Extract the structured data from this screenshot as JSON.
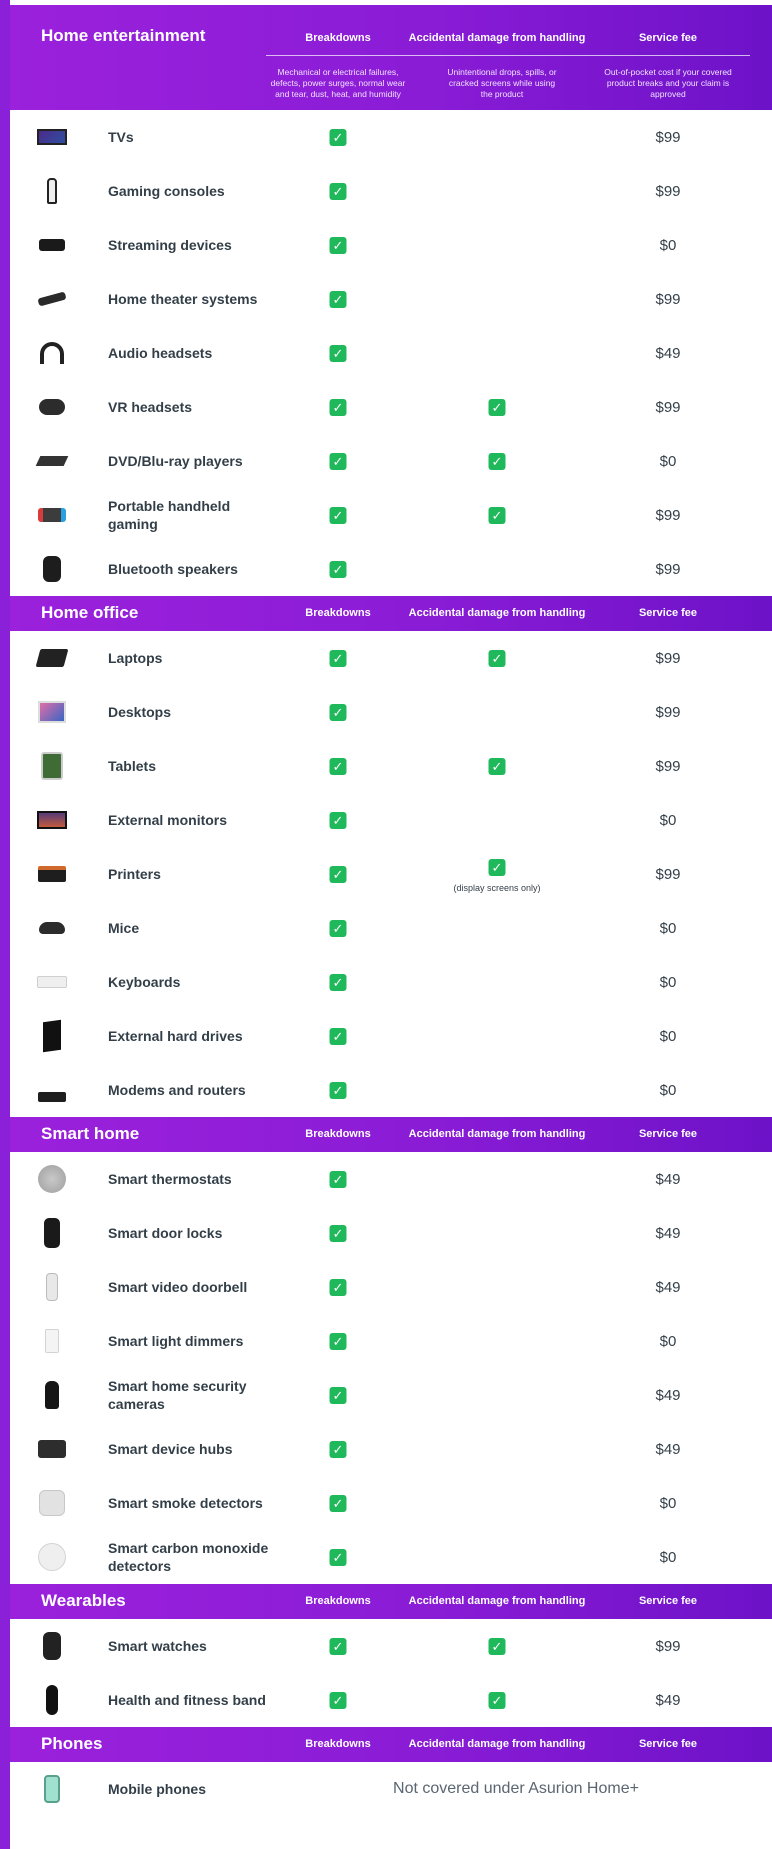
{
  "columns": {
    "breakdowns": "Breakdowns",
    "accidental": "Accidental damage from handling",
    "fee": "Service fee"
  },
  "descriptions": {
    "breakdowns": "Mechanical or electrical failures, defects, power surges, normal wear and tear, dust, heat, and humidity",
    "accidental": "Unintentional drops, spills, or cracked screens while using the product",
    "fee": "Out-of-pocket cost if your covered product breaks and your claim is approved"
  },
  "check_glyph": "✓",
  "sections": [
    {
      "title": "Home entertainment",
      "rows": [
        {
          "name": "TVs",
          "icon": "tv-icon",
          "breakdowns": true,
          "accidental": false,
          "fee": "$99"
        },
        {
          "name": "Gaming consoles",
          "icon": "gaming-console-icon",
          "breakdowns": true,
          "accidental": false,
          "fee": "$99"
        },
        {
          "name": "Streaming devices",
          "icon": "streaming-device-icon",
          "breakdowns": true,
          "accidental": false,
          "fee": "$0"
        },
        {
          "name": "Home theater systems",
          "icon": "soundbar-icon",
          "breakdowns": true,
          "accidental": false,
          "fee": "$99"
        },
        {
          "name": "Audio headsets",
          "icon": "headphones-icon",
          "breakdowns": true,
          "accidental": false,
          "fee": "$49"
        },
        {
          "name": "VR headsets",
          "icon": "vr-headset-icon",
          "breakdowns": true,
          "accidental": true,
          "fee": "$99"
        },
        {
          "name": "DVD/Blu-ray players",
          "icon": "disc-player-icon",
          "breakdowns": true,
          "accidental": true,
          "fee": "$0"
        },
        {
          "name": "Portable handheld gaming",
          "icon": "handheld-console-icon",
          "breakdowns": true,
          "accidental": true,
          "fee": "$99"
        },
        {
          "name": "Bluetooth speakers",
          "icon": "speaker-icon",
          "breakdowns": true,
          "accidental": false,
          "fee": "$99"
        }
      ]
    },
    {
      "title": "Home office",
      "rows": [
        {
          "name": "Laptops",
          "icon": "laptop-icon",
          "breakdowns": true,
          "accidental": true,
          "fee": "$99"
        },
        {
          "name": "Desktops",
          "icon": "desktop-icon",
          "breakdowns": true,
          "accidental": false,
          "fee": "$99"
        },
        {
          "name": "Tablets",
          "icon": "tablet-icon",
          "breakdowns": true,
          "accidental": true,
          "fee": "$99"
        },
        {
          "name": "External monitors",
          "icon": "monitor-icon",
          "breakdowns": true,
          "accidental": false,
          "fee": "$0"
        },
        {
          "name": "Printers",
          "icon": "printer-icon",
          "breakdowns": true,
          "accidental": true,
          "accidental_note": "(display screens only)",
          "fee": "$99"
        },
        {
          "name": "Mice",
          "icon": "mouse-icon",
          "breakdowns": true,
          "accidental": false,
          "fee": "$0"
        },
        {
          "name": "Keyboards",
          "icon": "keyboard-icon",
          "breakdowns": true,
          "accidental": false,
          "fee": "$0"
        },
        {
          "name": "External hard drives",
          "icon": "hard-drive-icon",
          "breakdowns": true,
          "accidental": false,
          "fee": "$0"
        },
        {
          "name": "Modems and routers",
          "icon": "router-icon",
          "breakdowns": true,
          "accidental": false,
          "fee": "$0"
        }
      ]
    },
    {
      "title": "Smart home",
      "rows": [
        {
          "name": "Smart thermostats",
          "icon": "thermostat-icon",
          "breakdowns": true,
          "accidental": false,
          "fee": "$49"
        },
        {
          "name": "Smart door locks",
          "icon": "door-lock-icon",
          "breakdowns": true,
          "accidental": false,
          "fee": "$49"
        },
        {
          "name": "Smart video doorbell",
          "icon": "doorbell-icon",
          "breakdowns": true,
          "accidental": false,
          "fee": "$49"
        },
        {
          "name": "Smart light dimmers",
          "icon": "dimmer-icon",
          "breakdowns": true,
          "accidental": false,
          "fee": "$0"
        },
        {
          "name": "Smart home security cameras",
          "icon": "security-camera-icon",
          "breakdowns": true,
          "accidental": false,
          "fee": "$49"
        },
        {
          "name": "Smart device hubs",
          "icon": "smart-hub-icon",
          "breakdowns": true,
          "accidental": false,
          "fee": "$49"
        },
        {
          "name": "Smart smoke detectors",
          "icon": "smoke-detector-icon",
          "breakdowns": true,
          "accidental": false,
          "fee": "$0"
        },
        {
          "name": "Smart carbon monoxide detectors",
          "icon": "co-detector-icon",
          "breakdowns": true,
          "accidental": false,
          "fee": "$0"
        }
      ]
    },
    {
      "title": "Wearables",
      "rows": [
        {
          "name": "Smart watches",
          "icon": "smart-watch-icon",
          "breakdowns": true,
          "accidental": true,
          "fee": "$99"
        },
        {
          "name": "Health and fitness band",
          "icon": "fitness-band-icon",
          "breakdowns": true,
          "accidental": true,
          "fee": "$49"
        }
      ]
    },
    {
      "title": "Phones",
      "rows": [
        {
          "name": "Mobile phones",
          "icon": "mobile-phone-icon",
          "not_covered": "Not covered under Asurion Home+"
        }
      ]
    }
  ]
}
